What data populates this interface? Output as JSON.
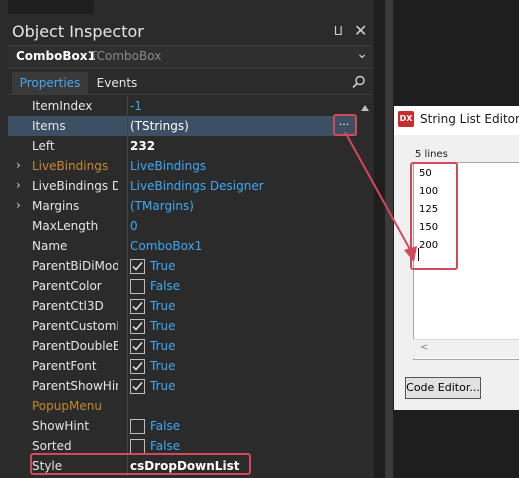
{
  "inspector": {
    "title": "Object Inspector",
    "pin_icon": "pin-icon",
    "close_icon": "close-icon",
    "component": {
      "name": "ComboBox1",
      "type": "TComboBox"
    },
    "tabs": [
      {
        "label": "Properties",
        "active": true
      },
      {
        "label": "Events",
        "active": false
      }
    ],
    "ellipsis_label": "...",
    "properties": [
      {
        "name": "ItemIndex",
        "value": "-1"
      },
      {
        "name": "Items",
        "value": "(TStrings)",
        "selected": true
      },
      {
        "name": "Left",
        "value": "232"
      },
      {
        "name": "LiveBindings",
        "value": "LiveBindings",
        "expandable": true
      },
      {
        "name": "LiveBindings Des",
        "value": "LiveBindings Designer",
        "expandable": true
      },
      {
        "name": "Margins",
        "value": "(TMargins)",
        "expandable": true
      },
      {
        "name": "MaxLength",
        "value": "0"
      },
      {
        "name": "Name",
        "value": "ComboBox1"
      },
      {
        "name": "ParentBiDiMode",
        "value": "True",
        "checked": true
      },
      {
        "name": "ParentColor",
        "value": "False",
        "checked": false
      },
      {
        "name": "ParentCtl3D",
        "value": "True",
        "checked": true
      },
      {
        "name": "ParentCustomHi",
        "value": "True",
        "checked": true
      },
      {
        "name": "ParentDoubleBu",
        "value": "True",
        "checked": true
      },
      {
        "name": "ParentFont",
        "value": "True",
        "checked": true
      },
      {
        "name": "ParentShowHint",
        "value": "True",
        "checked": true
      },
      {
        "name": "PopupMenu",
        "value": ""
      },
      {
        "name": "ShowHint",
        "value": "False",
        "checked": false
      },
      {
        "name": "Sorted",
        "value": "False",
        "checked": false
      },
      {
        "name": "Style",
        "value": "csDropDownList"
      }
    ]
  },
  "string_list_editor": {
    "logo": "DX",
    "title": "String List Editor",
    "lines_label": "5 lines",
    "lines": [
      "50",
      "100",
      "125",
      "150",
      "200"
    ],
    "code_editor_button": "Code Editor..."
  },
  "colors": {
    "accent": "#3fa9f5",
    "highlight": "#d24a5a",
    "selected_row": "#3d4f62"
  }
}
